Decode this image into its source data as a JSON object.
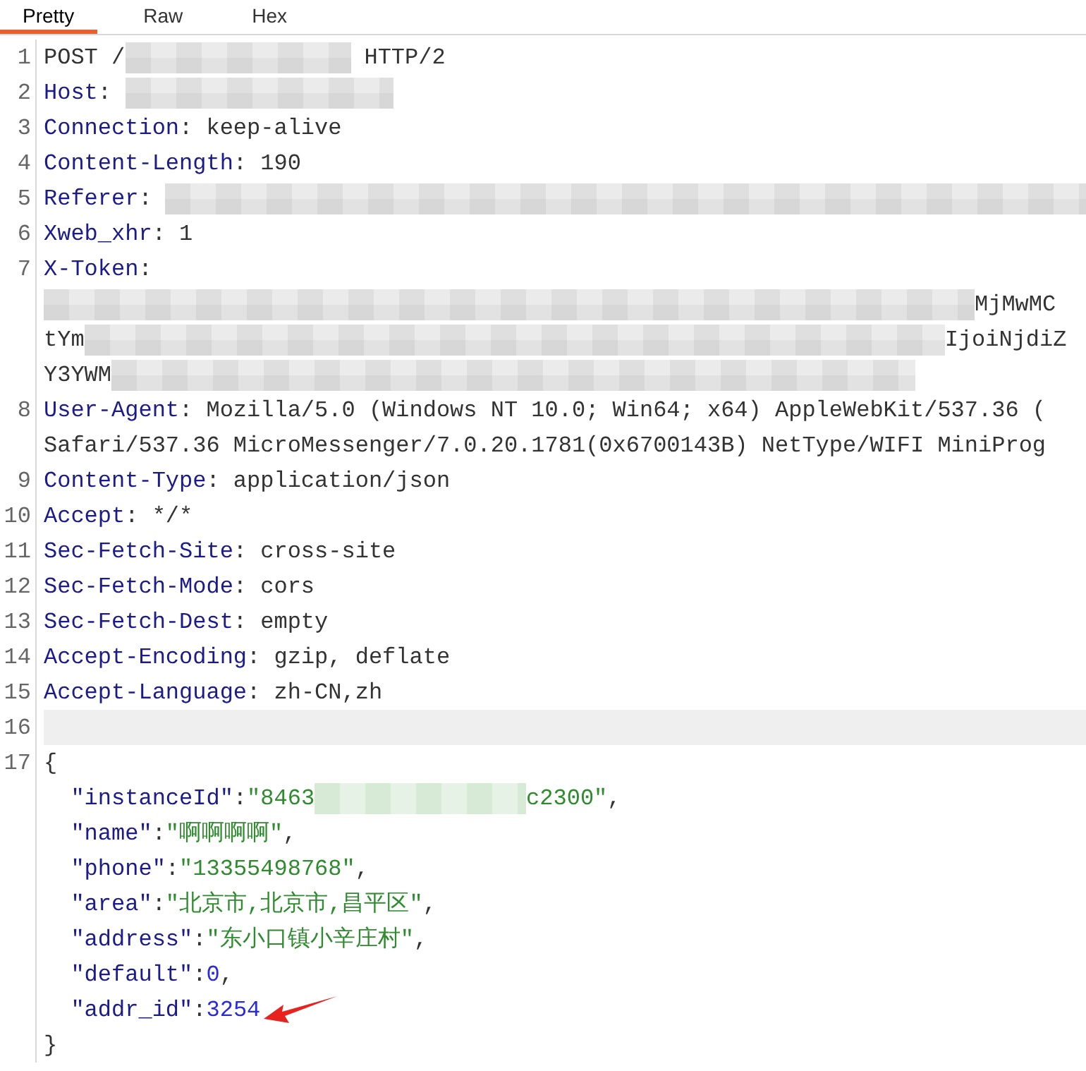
{
  "tabs": [
    {
      "label": "Pretty",
      "selected": true
    },
    {
      "label": "Raw",
      "selected": false
    },
    {
      "label": "Hex",
      "selected": false
    }
  ],
  "lines": [
    {
      "number": "1",
      "current": false,
      "arrow": false,
      "segments": [
        {
          "kind": "text",
          "text": "POST /"
        },
        {
          "kind": "redacted"
        },
        {
          "kind": "text",
          "text": " HTTP/2"
        }
      ]
    },
    {
      "number": "2",
      "current": false,
      "arrow": false,
      "segments": [
        {
          "kind": "key",
          "text": "Host"
        },
        {
          "kind": "text",
          "text": ": "
        },
        {
          "kind": "redacted"
        }
      ]
    },
    {
      "number": "3",
      "current": false,
      "arrow": false,
      "segments": [
        {
          "kind": "key",
          "text": "Connection"
        },
        {
          "kind": "text",
          "text": ": keep-alive"
        }
      ]
    },
    {
      "number": "4",
      "current": false,
      "arrow": false,
      "segments": [
        {
          "kind": "key",
          "text": "Content-Length"
        },
        {
          "kind": "text",
          "text": ": 190"
        }
      ]
    },
    {
      "number": "5",
      "current": false,
      "arrow": false,
      "segments": [
        {
          "kind": "key",
          "text": "Referer"
        },
        {
          "kind": "text",
          "text": ": "
        },
        {
          "kind": "redacted"
        }
      ]
    },
    {
      "number": "6",
      "current": false,
      "arrow": false,
      "segments": [
        {
          "kind": "key",
          "text": "Xweb_xhr"
        },
        {
          "kind": "text",
          "text": ": 1"
        }
      ]
    },
    {
      "number": "7",
      "current": false,
      "arrow": false,
      "segments": [
        {
          "kind": "key",
          "text": "X-Token"
        },
        {
          "kind": "text",
          "text": ":"
        }
      ]
    },
    {
      "current": false,
      "arrow": false,
      "segments": [
        {
          "kind": "redacted"
        },
        {
          "kind": "text",
          "text": "MjMwMC"
        }
      ]
    },
    {
      "current": false,
      "arrow": false,
      "segments": [
        {
          "kind": "text",
          "text": "tYm"
        },
        {
          "kind": "redacted"
        },
        {
          "kind": "text",
          "text": "IjoiNjdiZ"
        }
      ]
    },
    {
      "current": false,
      "arrow": false,
      "segments": [
        {
          "kind": "text",
          "text": "Y3YWM"
        },
        {
          "kind": "redacted"
        }
      ]
    },
    {
      "number": "8",
      "current": false,
      "arrow": false,
      "segments": [
        {
          "kind": "key",
          "text": "User-Agent"
        },
        {
          "kind": "text",
          "text": ": Mozilla/5.0 (Windows NT 10.0; Win64; x64) AppleWebKit/537.36 ("
        }
      ]
    },
    {
      "current": false,
      "arrow": false,
      "segments": [
        {
          "kind": "text",
          "text": "Safari/537.36 MicroMessenger/7.0.20.1781(0x6700143B) NetType/WIFI MiniProg"
        }
      ]
    },
    {
      "number": "9",
      "current": false,
      "arrow": false,
      "segments": [
        {
          "kind": "key",
          "text": "Content-Type"
        },
        {
          "kind": "text",
          "text": ": application/json"
        }
      ]
    },
    {
      "number": "10",
      "current": false,
      "arrow": false,
      "segments": [
        {
          "kind": "key",
          "text": "Accept"
        },
        {
          "kind": "text",
          "text": ": */*"
        }
      ]
    },
    {
      "number": "11",
      "current": false,
      "arrow": false,
      "segments": [
        {
          "kind": "key",
          "text": "Sec-Fetch-Site"
        },
        {
          "kind": "text",
          "text": ": cross-site"
        }
      ]
    },
    {
      "number": "12",
      "current": false,
      "arrow": false,
      "segments": [
        {
          "kind": "key",
          "text": "Sec-Fetch-Mode"
        },
        {
          "kind": "text",
          "text": ": cors"
        }
      ]
    },
    {
      "number": "13",
      "current": false,
      "arrow": false,
      "segments": [
        {
          "kind": "key",
          "text": "Sec-Fetch-Dest"
        },
        {
          "kind": "text",
          "text": ": empty"
        }
      ]
    },
    {
      "number": "14",
      "current": false,
      "arrow": false,
      "segments": [
        {
          "kind": "key",
          "text": "Accept-Encoding"
        },
        {
          "kind": "text",
          "text": ": gzip, deflate"
        }
      ]
    },
    {
      "number": "15",
      "current": false,
      "arrow": false,
      "segments": [
        {
          "kind": "key",
          "text": "Accept-Language"
        },
        {
          "kind": "text",
          "text": ": zh-CN,zh"
        }
      ]
    },
    {
      "number": "16",
      "current": true,
      "arrow": false
    },
    {
      "number": "17",
      "current": false,
      "arrow": false,
      "segments": [
        {
          "kind": "text",
          "text": "{"
        }
      ]
    },
    {
      "current": false,
      "arrow": false,
      "segments": [
        {
          "kind": "key",
          "text": "  \"instanceId\""
        },
        {
          "kind": "text",
          "text": ":"
        },
        {
          "kind": "str",
          "text": "\"8463"
        },
        {
          "kind": "redacted"
        },
        {
          "kind": "str",
          "text": "c2300\""
        },
        {
          "kind": "text",
          "text": ","
        }
      ]
    },
    {
      "current": false,
      "arrow": false,
      "segments": [
        {
          "kind": "key",
          "text": "  \"name\""
        },
        {
          "kind": "text",
          "text": ":"
        },
        {
          "kind": "str",
          "text": "\"啊啊啊啊\""
        },
        {
          "kind": "text",
          "text": ","
        }
      ]
    },
    {
      "current": false,
      "arrow": false,
      "segments": [
        {
          "kind": "key",
          "text": "  \"phone\""
        },
        {
          "kind": "text",
          "text": ":"
        },
        {
          "kind": "str",
          "text": "\"13355498768\""
        },
        {
          "kind": "text",
          "text": ","
        }
      ]
    },
    {
      "current": false,
      "arrow": false,
      "segments": [
        {
          "kind": "key",
          "text": "  \"area\""
        },
        {
          "kind": "text",
          "text": ":"
        },
        {
          "kind": "str",
          "text": "\"北京市,北京市,昌平区\""
        },
        {
          "kind": "text",
          "text": ","
        }
      ]
    },
    {
      "current": false,
      "arrow": false,
      "segments": [
        {
          "kind": "key",
          "text": "  \"address\""
        },
        {
          "kind": "text",
          "text": ":"
        },
        {
          "kind": "str",
          "text": "\"东小口镇小辛庄村\""
        },
        {
          "kind": "text",
          "text": ","
        }
      ]
    },
    {
      "current": false,
      "arrow": false,
      "segments": [
        {
          "kind": "key",
          "text": "  \"default\""
        },
        {
          "kind": "text",
          "text": ":"
        },
        {
          "kind": "num",
          "text": "0"
        },
        {
          "kind": "text",
          "text": ","
        }
      ]
    },
    {
      "current": false,
      "arrow": true,
      "segments": [
        {
          "kind": "key",
          "text": "  \"addr_id\""
        },
        {
          "kind": "text",
          "text": ":"
        },
        {
          "kind": "num",
          "text": "3254"
        }
      ]
    },
    {
      "current": false,
      "arrow": false,
      "segments": [
        {
          "kind": "text",
          "text": "}"
        }
      ]
    }
  ]
}
